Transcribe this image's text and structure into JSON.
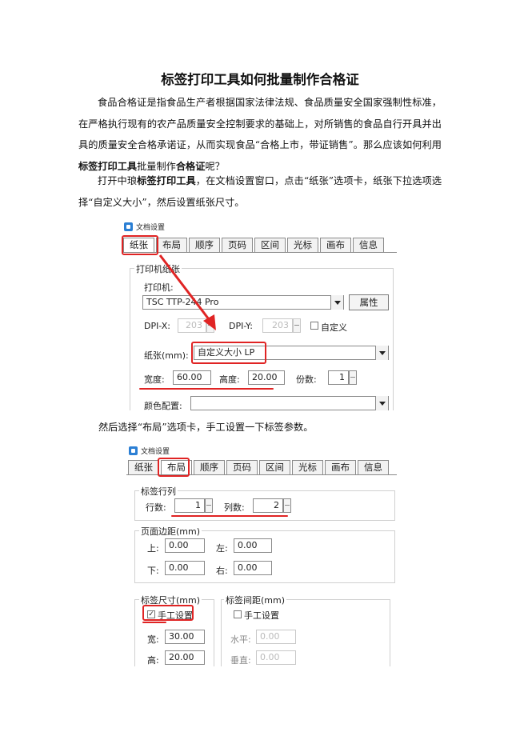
{
  "doc": {
    "title": "标签打印工具如何批量制作合格证",
    "p1": {
      "a": "食品合格证是指食品生产者根据国家法律法规、食品质量安全国家强制性标准，在严格执行现有的农产品质量安全控制要求的基础上，对所销售的食品自行开具并出具的质量安全合格承诺证，从而实现食品“合格上市，带证销售”。那么应该如何利用",
      "b": "标签打印工具",
      "c": "批量制作",
      "d": "合格证",
      "e": "呢？"
    },
    "p2": {
      "a": "打开中琅",
      "b": "标签打印工具",
      "c": "，在文档设置窗口，点击“纸张”选项卡，纸张下拉选项选择“自定义大小”，然后设置纸张尺寸。"
    },
    "p3": "然后选择“布局”选项卡，手工设置一下标签参数。"
  },
  "dialog1": {
    "window_title": "文档设置",
    "tabs": [
      "纸张",
      "布局",
      "顺序",
      "页码",
      "区间",
      "光标",
      "画布",
      "信息"
    ],
    "group_label": "打印机纸张",
    "printer_label": "打印机:",
    "printer_value": "TSC TTP-244 Pro",
    "properties_button": "属性",
    "dpix_label": "DPI-X:",
    "dpix_value": "203",
    "dpiy_label": "DPI-Y:",
    "dpiy_value": "203",
    "custom_label": "自定义",
    "paper_label": "纸张(mm):",
    "paper_value": "自定义大小 LP",
    "width_label": "宽度:",
    "width_value": "60.00",
    "height_label": "高度:",
    "height_value": "20.00",
    "copies_label": "份数:",
    "copies_value": "1",
    "color_label": "颜色配置:"
  },
  "dialog2": {
    "window_title": "文档设置",
    "tabs": [
      "纸张",
      "布局",
      "顺序",
      "页码",
      "区间",
      "光标",
      "画布",
      "信息"
    ],
    "rows_cols_group": "标签行列",
    "rows_label": "行数:",
    "rows_value": "1",
    "cols_label": "列数:",
    "cols_value": "2",
    "margin_group": "页面边距(mm)",
    "top_label": "上:",
    "top_value": "0.00",
    "left_label": "左:",
    "left_value": "0.00",
    "bottom_label": "下:",
    "bottom_value": "0.00",
    "right_label": "右:",
    "right_value": "0.00",
    "size_group": "标签尺寸(mm)",
    "manual_label": "手工设置",
    "manual_checked": true,
    "w_label": "宽:",
    "w_value": "30.00",
    "h_label": "高:",
    "h_value": "20.00",
    "gap_group": "标签间距(mm)",
    "gap_manual_label": "手工设置",
    "gap_manual_checked": false,
    "horiz_label": "水平:",
    "horiz_value": "0.00",
    "vert_label": "垂直:",
    "vert_value": "0.00"
  },
  "colors": {
    "annotation": "#e02424",
    "window_icon": "#2b7fd4"
  }
}
